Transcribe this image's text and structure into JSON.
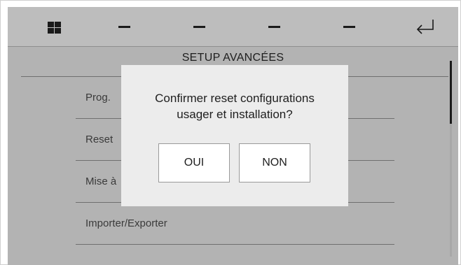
{
  "header": {
    "home_icon": "grid-icon",
    "tab_icons": [
      "dash-icon",
      "dash-icon",
      "dash-icon",
      "dash-icon"
    ],
    "back_icon": "enter-return-icon"
  },
  "page": {
    "title": "SETUP AVANCÉES"
  },
  "menu": {
    "items": [
      {
        "label": "Prog. "
      },
      {
        "label": "Reset"
      },
      {
        "label": "Mise à"
      },
      {
        "label": "Importer/Exporter"
      }
    ]
  },
  "dialog": {
    "message_line1": "Confirmer reset configurations",
    "message_line2": "usager et installation?",
    "yes_label": "OUI",
    "no_label": "NON"
  },
  "colors": {
    "device_bg": "#b3b3b3",
    "dialog_bg": "#ececec",
    "button_bg": "#ffffff",
    "text": "#1e1e1e"
  }
}
